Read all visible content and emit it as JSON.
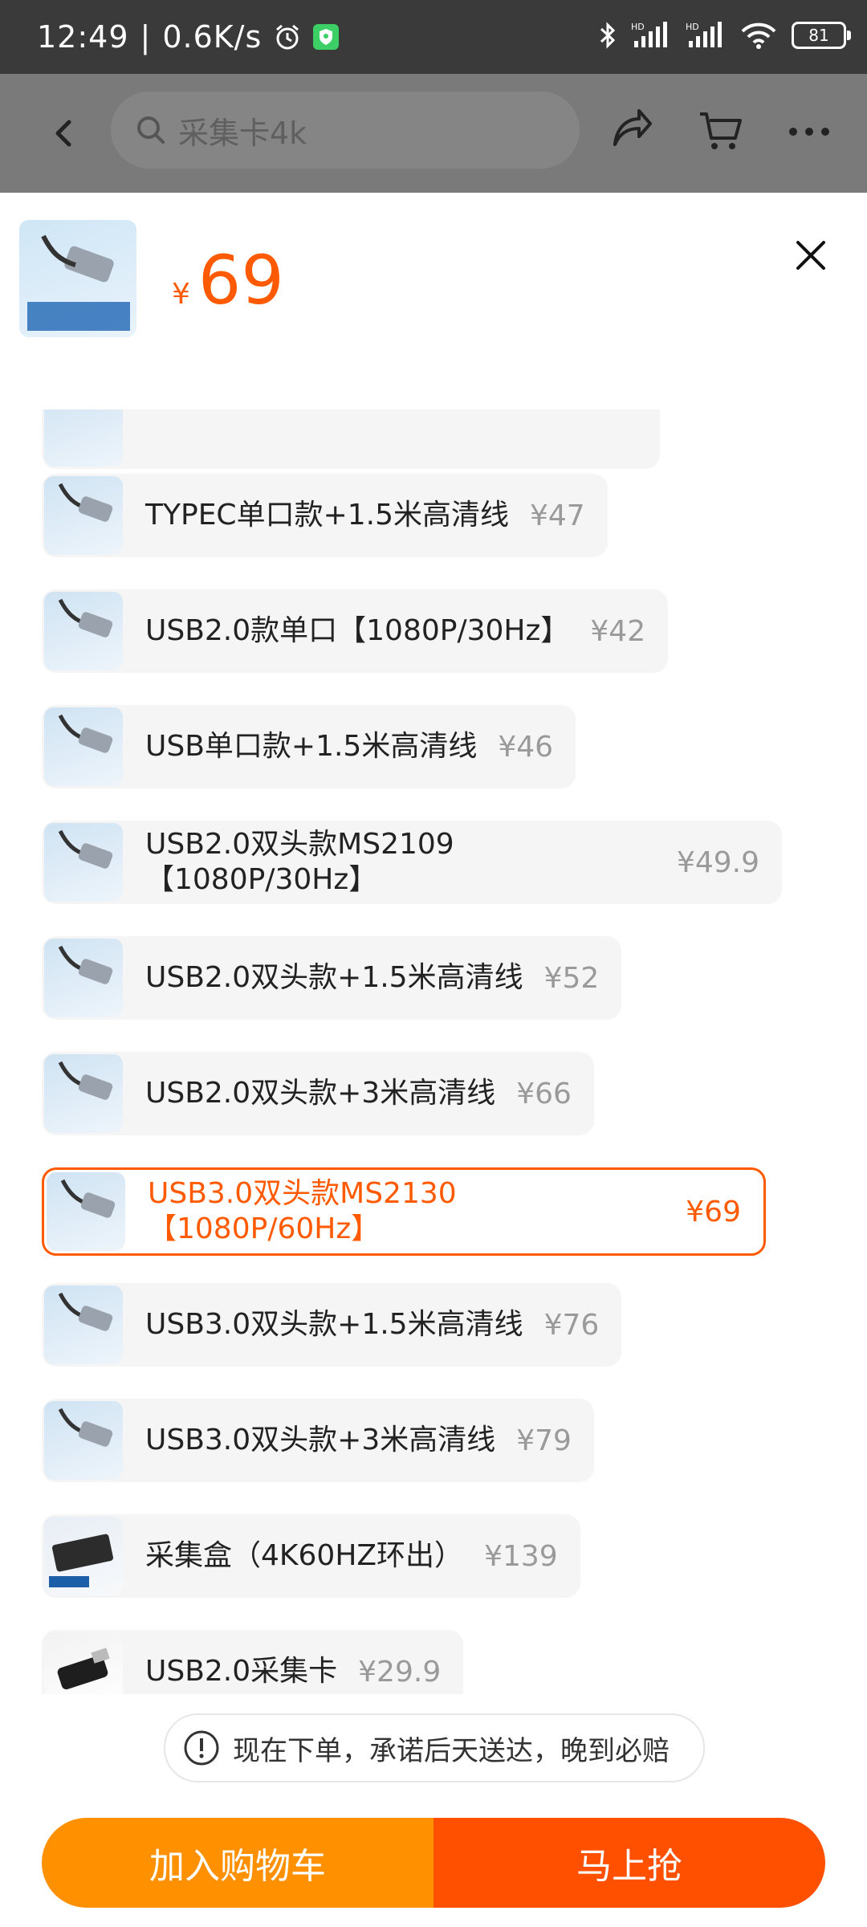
{
  "status_bar": {
    "time": "12:49",
    "net_speed": "0.6K/s",
    "battery": "81",
    "hd1": "HD",
    "hd2": "HD"
  },
  "header": {
    "search_placeholder": "采集卡4k"
  },
  "product": {
    "currency": "¥",
    "price": "69"
  },
  "options": [
    {
      "label": "TYPEC单口款+1.5米高清线",
      "price": "¥47"
    },
    {
      "label": "USB2.0款单口【1080P/30Hz】",
      "price": "¥42"
    },
    {
      "label": "USB单口款+1.5米高清线",
      "price": "¥46"
    },
    {
      "label": "USB2.0双头款MS2109【1080P/30Hz】",
      "price": "¥49.9"
    },
    {
      "label": "USB2.0双头款+1.5米高清线",
      "price": "¥52"
    },
    {
      "label": "USB2.0双头款+3米高清线",
      "price": "¥66"
    },
    {
      "label": "USB3.0双头款MS2130【1080P/60Hz】",
      "price": "¥69",
      "selected": true
    },
    {
      "label": "USB3.0双头款+1.5米高清线",
      "price": "¥76"
    },
    {
      "label": "USB3.0双头款+3米高清线",
      "price": "¥79"
    },
    {
      "label": "采集盒（4K60HZ环出）",
      "price": "¥139"
    },
    {
      "label": "USB2.0采集卡",
      "price": "¥29.9"
    }
  ],
  "guarantee": {
    "text": "现在下单，承诺后天送达，晚到必赔"
  },
  "buttons": {
    "add_to_cart": "加入购物车",
    "buy_now": "马上抢"
  },
  "colors": {
    "accent": "#ff5a00",
    "cart_button": "#ff9000",
    "buy_button": "#ff5000"
  }
}
